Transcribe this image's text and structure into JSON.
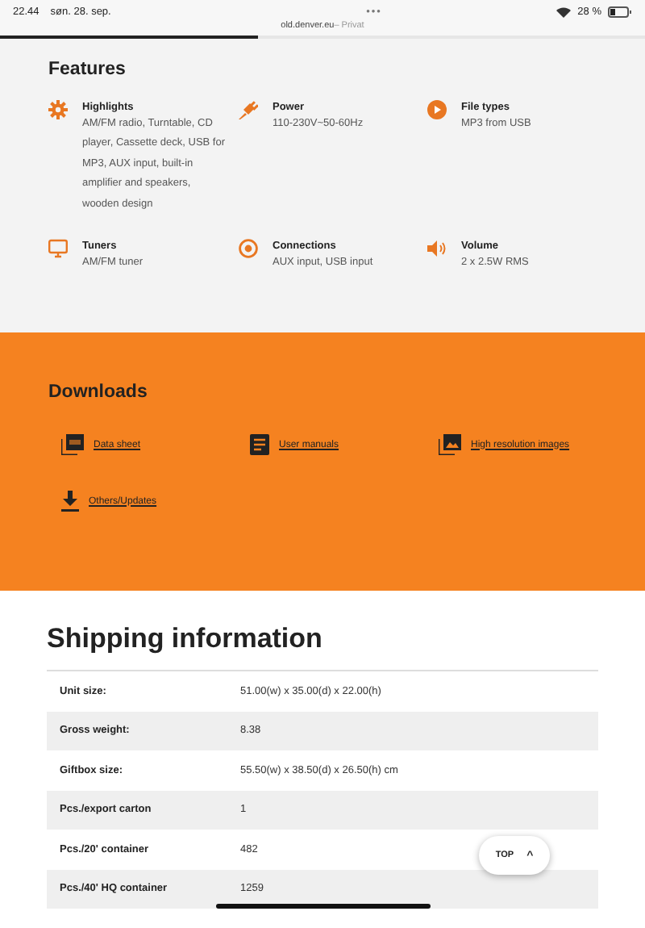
{
  "status_bar": {
    "time": "22.44",
    "date": "søn. 28. sep.",
    "dots": "•••",
    "address": "old.denver.eu",
    "mode": "– Privat",
    "battery": "28 %",
    "load": {
      "level": 0.4
    }
  },
  "features": {
    "title": "Features",
    "items": [
      {
        "kind": "gear",
        "title": "Highlights",
        "text": "AM/FM radio, Turntable, CD player, Cassette deck, USB for MP3, AUX input, built-in amplifier and speakers, wooden design"
      },
      {
        "kind": "plug",
        "title": "Power",
        "text": "110-230V~50-60Hz"
      },
      {
        "kind": "play",
        "title": "File types",
        "text": "MP3 from USB"
      },
      {
        "kind": "monitor",
        "title": "Tuners",
        "text": "AM/FM tuner"
      },
      {
        "kind": "target",
        "title": "Connections",
        "text": "AUX input, USB input"
      },
      {
        "kind": "speaker",
        "title": "Volume",
        "text": "2 x 2.5W RMS"
      }
    ]
  },
  "downloads": {
    "title": "Downloads",
    "items": [
      {
        "kind": "pdf",
        "label": "Data sheet"
      },
      {
        "kind": "doc",
        "label": "User manuals"
      },
      {
        "kind": "images",
        "label": "High resolution images"
      },
      {
        "kind": "download",
        "label": "Others/Updates"
      }
    ]
  },
  "shipping": {
    "title": "Shipping information",
    "rows": [
      {
        "label": "Unit size:",
        "value": "51.00(w) x 35.00(d) x 22.00(h)"
      },
      {
        "label": "Gross weight:",
        "value": "8.38"
      },
      {
        "label": "Giftbox size:",
        "value": "55.50(w) x 38.50(d) x 26.50(h) cm"
      },
      {
        "label": "Pcs./export carton",
        "value": "1"
      },
      {
        "label": "Pcs./20' container",
        "value": "482"
      },
      {
        "label": "Pcs./40' HQ container",
        "value": "1259"
      }
    ]
  },
  "top_button": {
    "label": "TOP",
    "arrow": "^"
  }
}
